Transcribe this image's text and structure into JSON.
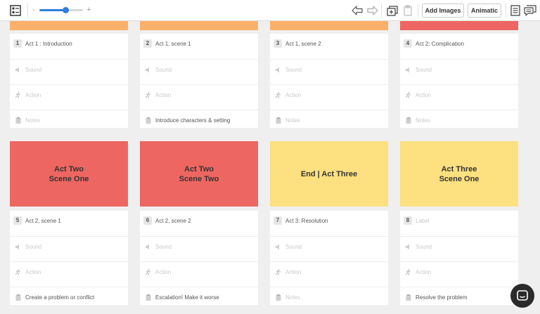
{
  "toolbar": {
    "zoom_minus": "-",
    "zoom_plus": "+",
    "zoom_level": 0.6,
    "add_images_label": "Add Images",
    "animatic_label": "Animatic"
  },
  "colors": {
    "accent": "#2f7de1",
    "orange": "#fdb06a",
    "red": "#ee6661",
    "yellow": "#fde07f"
  },
  "placeholders": {
    "label": "Label",
    "sound": "Sound",
    "action": "Action",
    "notes": "Notes"
  },
  "frames": [
    {
      "number": "1",
      "thumb_color": "#fdb06a",
      "thumb_text": "",
      "label": "Act 1 : Introduction",
      "sound": "",
      "action": "",
      "notes": ""
    },
    {
      "number": "2",
      "thumb_color": "#fdb06a",
      "thumb_text": "",
      "label": "Act 1, scene 1",
      "sound": "",
      "action": "",
      "notes": "Introduce characters & setting"
    },
    {
      "number": "3",
      "thumb_color": "#fdb06a",
      "thumb_text": "",
      "label": "Act 1, scene 2",
      "sound": "",
      "action": "",
      "notes": ""
    },
    {
      "number": "4",
      "thumb_color": "#ee6661",
      "thumb_text": "",
      "label": "Act 2: Complication",
      "sound": "",
      "action": "",
      "notes": ""
    },
    {
      "number": "5",
      "thumb_color": "#ee6661",
      "thumb_text": "Act Two\nScene One",
      "label": "Act 2, scene 1",
      "sound": "",
      "action": "",
      "notes": "Create a problem or conflict"
    },
    {
      "number": "6",
      "thumb_color": "#ee6661",
      "thumb_text": "Act Two\nScene Two",
      "label": "Act 2, scene 2",
      "sound": "",
      "action": "",
      "notes": "Escalation! Make it worse"
    },
    {
      "number": "7",
      "thumb_color": "#fde07f",
      "thumb_text": "End | Act Three",
      "label": "Act 3: Resolution",
      "sound": "",
      "action": "",
      "notes": ""
    },
    {
      "number": "8",
      "thumb_color": "#fde07f",
      "thumb_text": "Act Three\nScene One",
      "label": "",
      "sound": "",
      "action": "",
      "notes": "Resolve the problem"
    }
  ]
}
